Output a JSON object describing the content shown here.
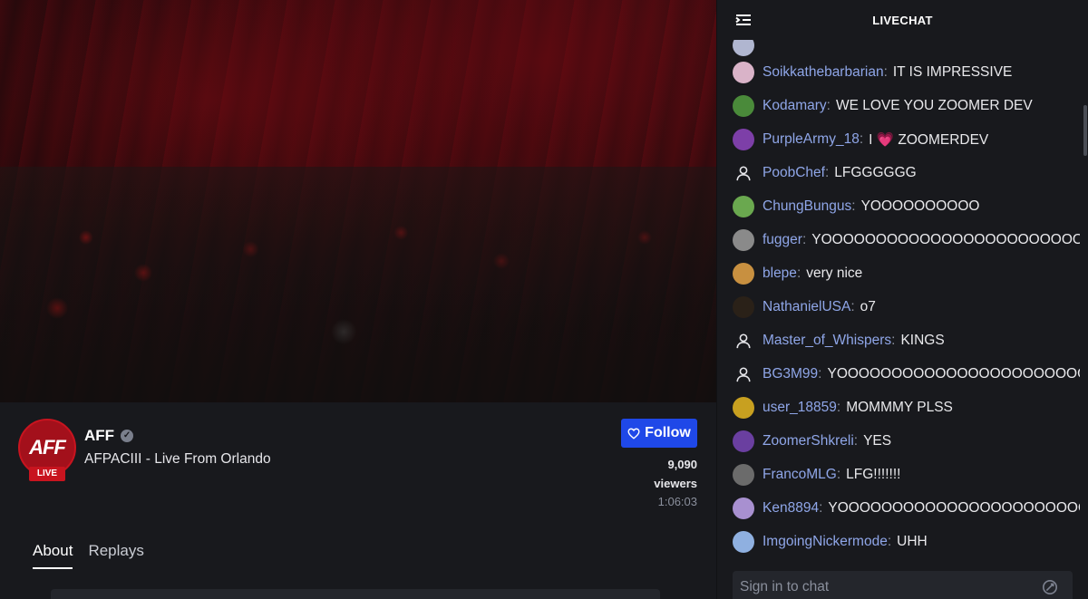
{
  "channel": {
    "avatar_text": "AFF",
    "live_label": "LIVE",
    "name": "AFF",
    "title": "AFPACIII - Live From Orlando",
    "follow_label": "Follow",
    "viewers_count": "9,090",
    "viewers_label": "viewers",
    "uptime": "1:06:03"
  },
  "tabs": [
    {
      "label": "About"
    },
    {
      "label": "Replays"
    }
  ],
  "chat": {
    "title": "LIVECHAT",
    "input_placeholder": "Sign in to chat",
    "messages": [
      {
        "user": "Soikkathebarbarian",
        "text": "IT IS IMPRESSIVE",
        "color": "#d9b3c8"
      },
      {
        "user": "Kodamary",
        "text": "WE LOVE YOU ZOOMER DEV",
        "color": "#4a8a3a"
      },
      {
        "user": "PurpleArmy_18",
        "text": "I 💗 ZOOMERDEV",
        "color": "#7d3fa8"
      },
      {
        "user": "PoobChef",
        "text": "LFGGGGGG",
        "color": "default"
      },
      {
        "user": "ChungBungus",
        "text": "YOOOOOOOOOO",
        "color": "#6aa84f"
      },
      {
        "user": "fugger",
        "text": "YOOOOOOOOOOOOOOOOOOOOOOOO",
        "color": "#8a8a8a"
      },
      {
        "user": "blepe",
        "text": "very nice",
        "color": "#c89040"
      },
      {
        "user": "NathanielUSA",
        "text": "o7",
        "color": "#2a2118"
      },
      {
        "user": "Master_of_Whispers",
        "text": "KINGS",
        "color": "default"
      },
      {
        "user": "BG3M99",
        "text": "YOOOOOOOOOOOOOOOOOOOOOOOO",
        "color": "default"
      },
      {
        "user": "user_18859",
        "text": "MOMMMY PLSS",
        "color": "#c8a020"
      },
      {
        "user": "ZoomerShkreli",
        "text": "YES",
        "color": "#6a3fa0"
      },
      {
        "user": "FrancoMLG",
        "text": "LFG!!!!!!!",
        "color": "#6b6b6b"
      },
      {
        "user": "Ken8894",
        "text": "YOOOOOOOOOOOOOOOOOOOOOOOOOOC",
        "color": "#a890d0"
      },
      {
        "user": "ImgoingNickermode",
        "text": "UHH",
        "color": "#8fb0e0"
      }
    ]
  }
}
